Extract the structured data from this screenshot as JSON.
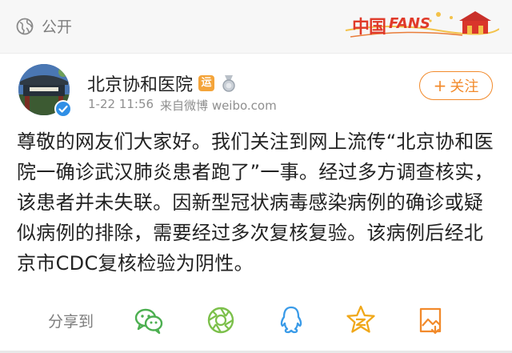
{
  "header": {
    "visibility_label": "公开",
    "visibility_icon": "globe-icon",
    "badge_cn": "中国",
    "badge_en": "FANS"
  },
  "post": {
    "author_name": "北京协和医院",
    "member_badge": "运",
    "timestamp": "1-22 11:56",
    "source": "来自微博 weibo.com",
    "follow_label": "关注",
    "text": "尊敬的网友们大家好。我们关注到网上流传“北京协和医院一确诊武汉肺炎患者跑了”一事。经过多方调查核实，该患者并未失联。因新型冠状病毒感染病例的确诊或疑似病例的排除，需要经过多次复核复验。该病例后经北京市CDC复核检验为阴性。"
  },
  "share": {
    "label": "分享到",
    "icons": [
      "wechat-icon",
      "moments-icon",
      "qq-icon",
      "qzone-icon",
      "save-image-icon"
    ]
  },
  "colors": {
    "accent": "#f28a2b",
    "icon_green": "#5cb85c",
    "icon_blue": "#3a9be8",
    "icon_gold": "#f0a81a"
  }
}
